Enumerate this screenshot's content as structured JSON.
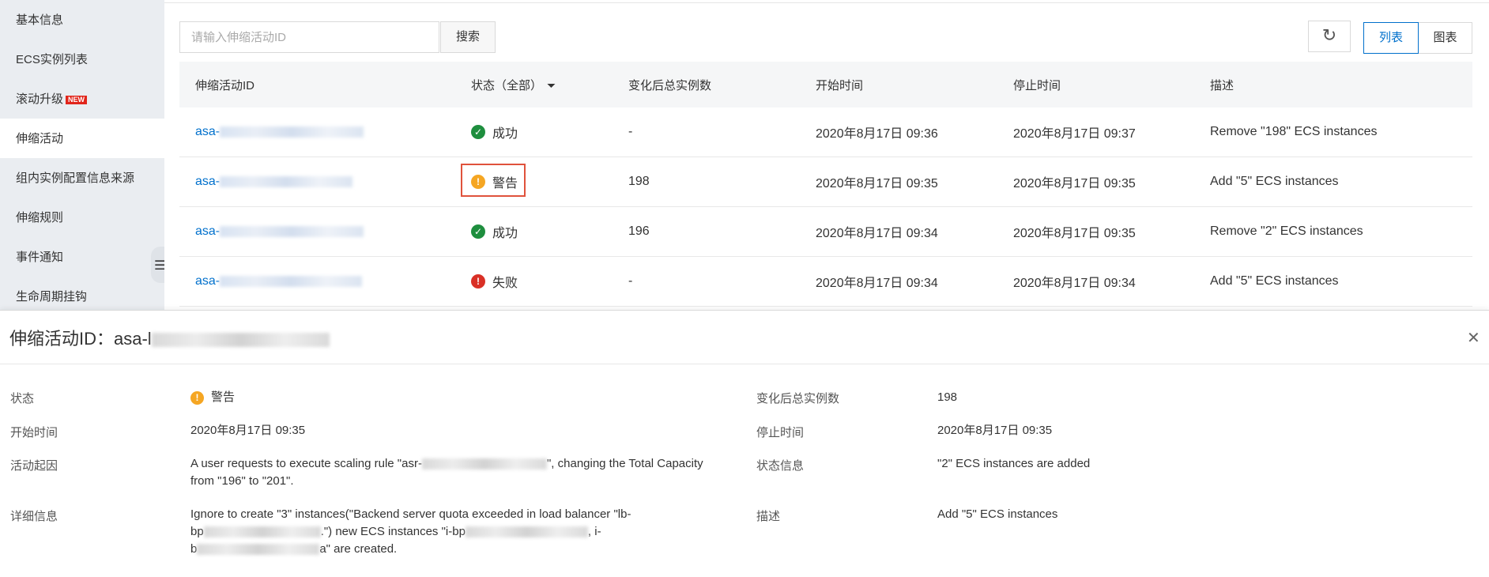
{
  "sidebar": {
    "items": [
      {
        "label": "基本信息"
      },
      {
        "label": "ECS实例列表"
      },
      {
        "label": "滚动升级",
        "badge": "NEW"
      },
      {
        "label": "伸缩活动"
      },
      {
        "label": "组内实例配置信息来源"
      },
      {
        "label": "伸缩规则"
      },
      {
        "label": "事件通知"
      },
      {
        "label": "生命周期挂钩"
      }
    ],
    "collapse_icon": "list-collapse-icon"
  },
  "toolbar": {
    "search_placeholder": "请输入伸缩活动ID",
    "search_label": "搜索",
    "refresh_icon": "refresh-icon",
    "view_list_label": "列表",
    "view_chart_label": "图表"
  },
  "table": {
    "columns": [
      "伸缩活动ID",
      "状态（全部）",
      "变化后总实例数",
      "开始时间",
      "停止时间",
      "描述"
    ],
    "rows": [
      {
        "id_prefix": "asa-",
        "status": "成功",
        "status_type": "success",
        "total": "-",
        "start": "2020年8月17日 09:36",
        "stop": "2020年8月17日 09:37",
        "desc": "Remove \"198\" ECS instances"
      },
      {
        "id_prefix": "asa-",
        "status": "警告",
        "status_type": "warning",
        "total": "198",
        "start": "2020年8月17日 09:35",
        "stop": "2020年8月17日 09:35",
        "desc": "Add \"5\" ECS instances"
      },
      {
        "id_prefix": "asa-",
        "status": "成功",
        "status_type": "success",
        "total": "196",
        "start": "2020年8月17日 09:34",
        "stop": "2020年8月17日 09:35",
        "desc": "Remove \"2\" ECS instances"
      },
      {
        "id_prefix": "asa-",
        "status": "失败",
        "status_type": "error",
        "total": "-",
        "start": "2020年8月17日 09:34",
        "stop": "2020年8月17日 09:34",
        "desc": "Add \"5\" ECS instances"
      }
    ]
  },
  "detail": {
    "title_prefix": "伸缩活动ID：asa-l",
    "close_icon": "close-icon",
    "labels": {
      "status": "状态",
      "start": "开始时间",
      "cause": "活动起因",
      "details": "详细信息",
      "total": "变化后总实例数",
      "stop": "停止时间",
      "status_info": "状态信息",
      "desc": "描述"
    },
    "values": {
      "status": "警告",
      "start": "2020年8月17日 09:35",
      "cause_part1": "A user requests to execute scaling rule \"asr-",
      "cause_part2": "\", changing the Total Capacity",
      "cause_line2": "from \"196\" to \"201\".",
      "details_line1": "Ignore to create \"3\" instances(\"Backend server quota exceeded in load balancer \"lb-",
      "details_line2_a": "bp",
      "details_line2_b": ".\") new ECS instances \"i-bp",
      "details_line2_c": ", i-",
      "details_line3_a": "b",
      "details_line3_b": "a\" are created.",
      "total": "198",
      "stop": "2020年8月17日 09:35",
      "status_info": "\"2\" ECS instances are added",
      "desc": "Add \"5\" ECS instances"
    }
  }
}
